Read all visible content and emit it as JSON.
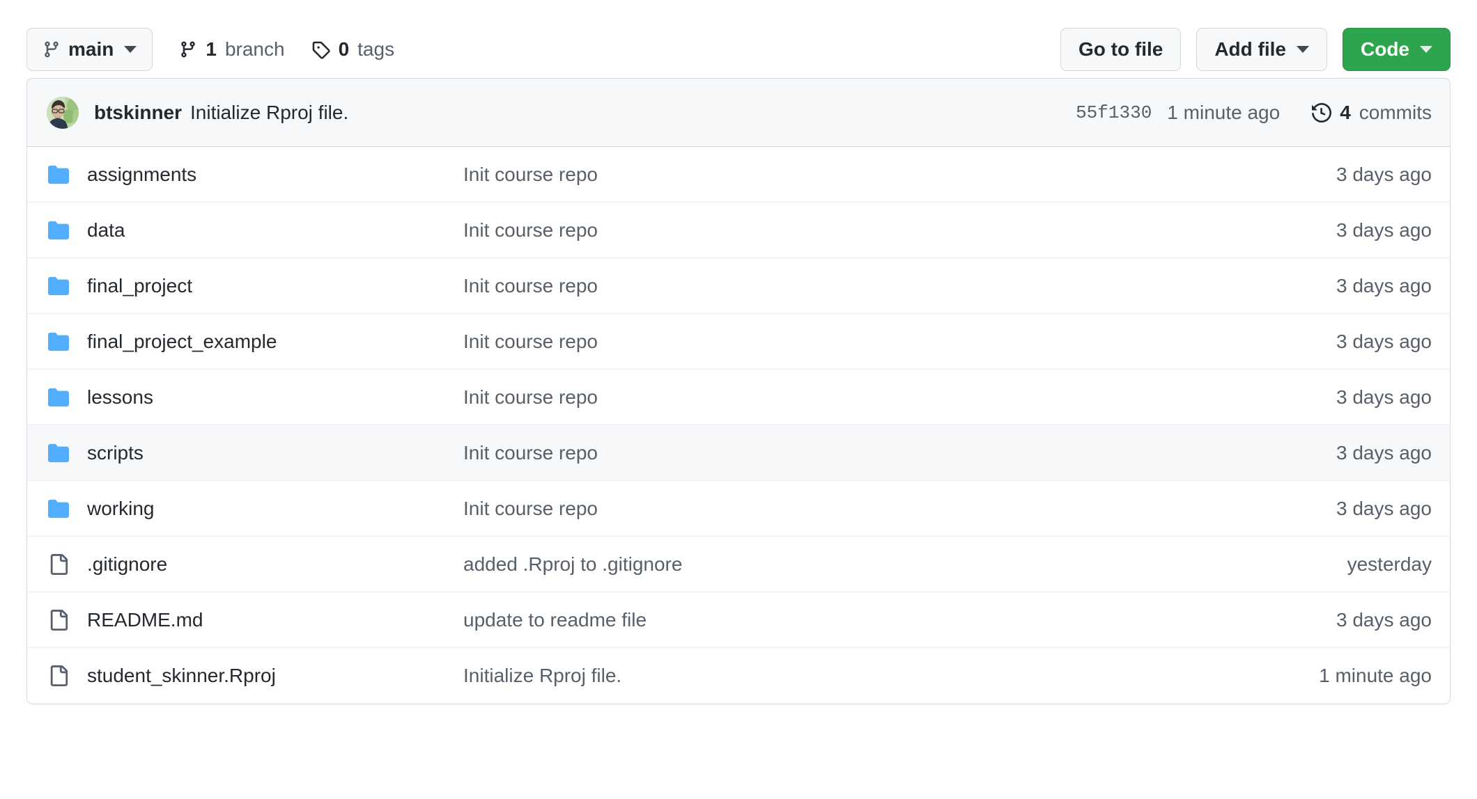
{
  "toolbar": {
    "branch_button": {
      "label": "main",
      "icon": "git-branch-icon",
      "caret": true
    },
    "branches": {
      "count": "1",
      "word": "branch",
      "icon": "git-branch-icon"
    },
    "tags": {
      "count": "0",
      "word": "tags",
      "icon": "tag-icon"
    },
    "go_to_file": "Go to file",
    "add_file": "Add file",
    "code": "Code"
  },
  "commit_bar": {
    "author": "btskinner",
    "message": "Initialize Rproj file.",
    "sha": "55f1330",
    "relative_time": "1 minute ago",
    "commits_count": "4",
    "commits_label": "commits",
    "history_icon": "history-icon",
    "avatar": "avatar"
  },
  "colors": {
    "accent_green": "#2da44e",
    "folder_blue": "#54aeff",
    "file_gray": "#57606a",
    "link_blue": "#0969da",
    "border": "#d0d7de",
    "row_border": "#eaeef2",
    "hover_bg": "#f6f8fa",
    "text_primary": "#24292f",
    "text_muted": "#57606a"
  },
  "files": [
    {
      "name": "assignments",
      "type": "folder",
      "icon": "folder-icon",
      "message": "Init course repo",
      "age": "3 days ago",
      "hovered": false
    },
    {
      "name": "data",
      "type": "folder",
      "icon": "folder-icon",
      "message": "Init course repo",
      "age": "3 days ago",
      "hovered": false
    },
    {
      "name": "final_project",
      "type": "folder",
      "icon": "folder-icon",
      "message": "Init course repo",
      "age": "3 days ago",
      "hovered": false
    },
    {
      "name": "final_project_example",
      "type": "folder",
      "icon": "folder-icon",
      "message": "Init course repo",
      "age": "3 days ago",
      "hovered": false
    },
    {
      "name": "lessons",
      "type": "folder",
      "icon": "folder-icon",
      "message": "Init course repo",
      "age": "3 days ago",
      "hovered": false
    },
    {
      "name": "scripts",
      "type": "folder",
      "icon": "folder-icon",
      "message": "Init course repo",
      "age": "3 days ago",
      "hovered": true
    },
    {
      "name": "working",
      "type": "folder",
      "icon": "folder-icon",
      "message": "Init course repo",
      "age": "3 days ago",
      "hovered": false
    },
    {
      "name": ".gitignore",
      "type": "file",
      "icon": "file-icon",
      "message": "added .Rproj to .gitignore",
      "age": "yesterday",
      "hovered": false
    },
    {
      "name": "README.md",
      "type": "file",
      "icon": "file-icon",
      "message": "update to readme file",
      "age": "3 days ago",
      "hovered": false
    },
    {
      "name": "student_skinner.Rproj",
      "type": "file",
      "icon": "file-icon",
      "message": "Initialize Rproj file.",
      "age": "1 minute ago",
      "hovered": false
    }
  ]
}
